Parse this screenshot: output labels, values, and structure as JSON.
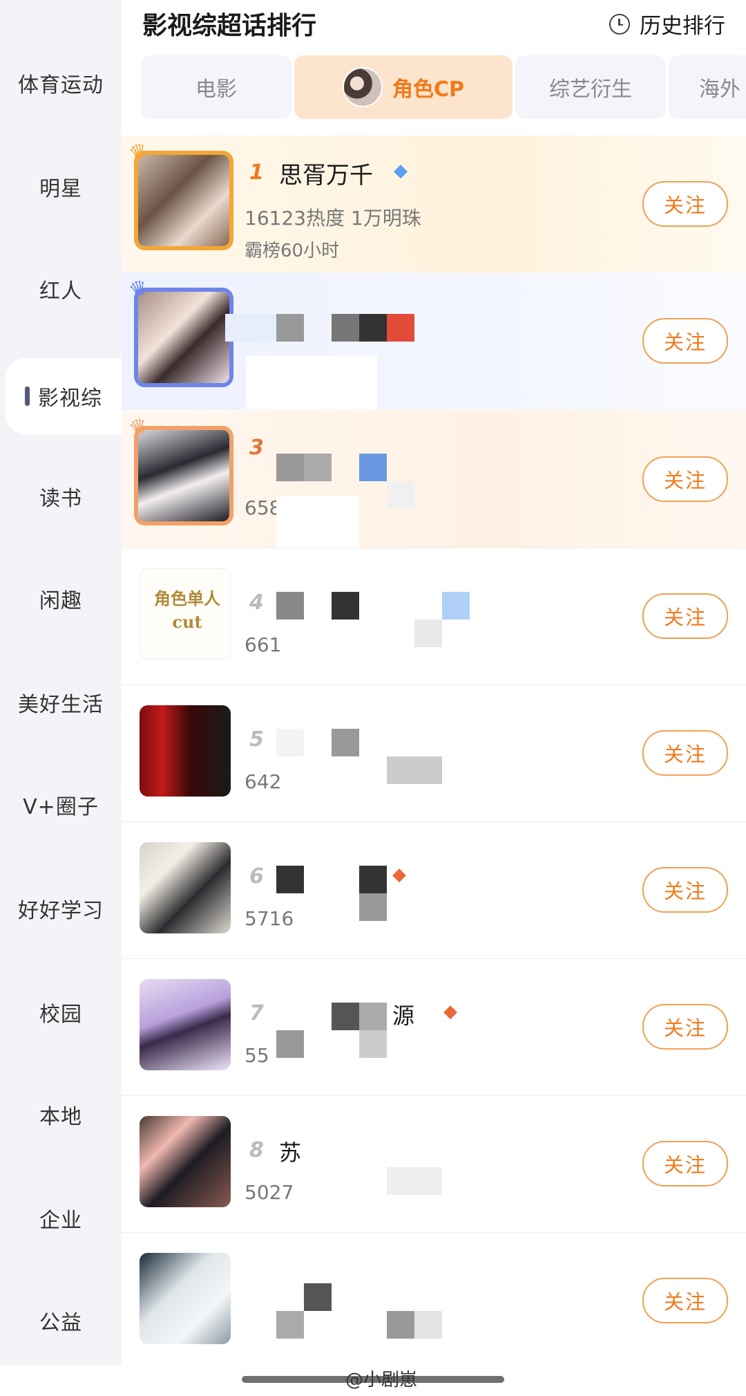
{
  "header": {
    "title": "影视综超话排行",
    "history_label": "历史排行"
  },
  "sidebar": {
    "items": [
      {
        "label": "体育运动"
      },
      {
        "label": "明星"
      },
      {
        "label": "红人"
      },
      {
        "label": "影视综"
      },
      {
        "label": "读书"
      },
      {
        "label": "闲趣"
      },
      {
        "label": "美好生活"
      },
      {
        "label": "V+圈子"
      },
      {
        "label": "好好学习"
      },
      {
        "label": "校园"
      },
      {
        "label": "本地"
      },
      {
        "label": "企业"
      },
      {
        "label": "公益"
      }
    ],
    "active_index": 3
  },
  "tabs": [
    {
      "label": "电影"
    },
    {
      "label": "角色CP"
    },
    {
      "label": "综艺衍生"
    },
    {
      "label": "海外"
    }
  ],
  "list": {
    "follow_label": "关注",
    "items": [
      {
        "rank": "1",
        "name": "思胥万千",
        "stat": "16123热度 1万明珠",
        "stat2": "霸榜60小时"
      },
      {
        "rank": "",
        "name": "",
        "stat": "",
        "stat2": ""
      },
      {
        "rank": "3",
        "name": "",
        "stat": "658",
        "stat2": ""
      },
      {
        "rank": "4",
        "name": "",
        "stat": "661",
        "stat2": "",
        "thumb_text": "角色单人cut"
      },
      {
        "rank": "5",
        "name": "",
        "stat": "642",
        "stat2": ""
      },
      {
        "rank": "6",
        "name": "",
        "stat": "5716",
        "stat2": ""
      },
      {
        "rank": "7",
        "name": "源",
        "stat": "55",
        "stat2": ""
      },
      {
        "rank": "8",
        "name": "苏",
        "stat": "5027",
        "stat2": ""
      },
      {
        "rank": "",
        "name": "",
        "stat": "",
        "stat2": ""
      }
    ]
  },
  "watermark": "@小剧崽",
  "colors": {
    "accent": "#f07a1c",
    "active_tab_bg": "#fde4cc",
    "sidebar_bg": "#f4f4f8"
  }
}
